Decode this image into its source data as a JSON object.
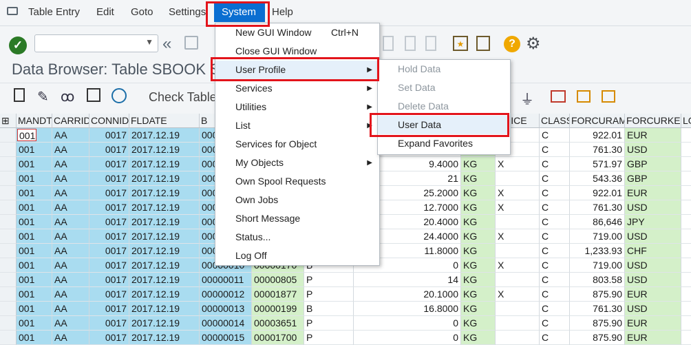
{
  "menubar": {
    "items": [
      {
        "label": "Table Entry"
      },
      {
        "label": "Edit"
      },
      {
        "label": "Goto"
      },
      {
        "label": "Settings"
      },
      {
        "label": "System"
      },
      {
        "label": "Help"
      }
    ]
  },
  "title": "Data Browser: Table SBOOK S",
  "app_toolbar": {
    "check_table": "Check Table"
  },
  "columns": [
    "MANDT",
    "CARRID",
    "CONNID",
    "FLDATE",
    "B",
    "",
    "",
    "",
    "",
    "",
    "VOICE",
    "CLASS",
    "FORCURAM",
    "FORCURKEY",
    "LO"
  ],
  "rows": [
    {
      "mandt": "001",
      "carrid": "AA",
      "connid": "0017",
      "fldate": "2017.12.19",
      "bookid": "000",
      "customid": "",
      "custtype": "",
      "luggweight": "",
      "wunit": "",
      "invoice": "",
      "class": "C",
      "forcuram": "922.01",
      "forcurkey": "EUR"
    },
    {
      "mandt": "001",
      "carrid": "AA",
      "connid": "0017",
      "fldate": "2017.12.19",
      "bookid": "000",
      "customid": "",
      "custtype": "",
      "luggweight": "",
      "wunit": "",
      "invoice": "",
      "class": "C",
      "forcuram": "761.30",
      "forcurkey": "USD"
    },
    {
      "mandt": "001",
      "carrid": "AA",
      "connid": "0017",
      "fldate": "2017.12.19",
      "bookid": "000",
      "customid": "",
      "custtype": "",
      "luggweight": "9.4000",
      "wunit": "KG",
      "invoice": "X",
      "class": "C",
      "forcuram": "571.97",
      "forcurkey": "GBP"
    },
    {
      "mandt": "001",
      "carrid": "AA",
      "connid": "0017",
      "fldate": "2017.12.19",
      "bookid": "000",
      "customid": "",
      "custtype": "",
      "luggweight": "21",
      "wunit": "KG",
      "invoice": "",
      "class": "C",
      "forcuram": "543.36",
      "forcurkey": "GBP"
    },
    {
      "mandt": "001",
      "carrid": "AA",
      "connid": "0017",
      "fldate": "2017.12.19",
      "bookid": "000",
      "customid": "",
      "custtype": "",
      "luggweight": "25.2000",
      "wunit": "KG",
      "invoice": "X",
      "class": "C",
      "forcuram": "922.01",
      "forcurkey": "EUR"
    },
    {
      "mandt": "001",
      "carrid": "AA",
      "connid": "0017",
      "fldate": "2017.12.19",
      "bookid": "000",
      "customid": "",
      "custtype": "",
      "luggweight": "12.7000",
      "wunit": "KG",
      "invoice": "X",
      "class": "C",
      "forcuram": "761.30",
      "forcurkey": "USD"
    },
    {
      "mandt": "001",
      "carrid": "AA",
      "connid": "0017",
      "fldate": "2017.12.19",
      "bookid": "000",
      "customid": "",
      "custtype": "",
      "luggweight": "20.4000",
      "wunit": "KG",
      "invoice": "",
      "class": "C",
      "forcuram": "86,646",
      "forcurkey": "JPY"
    },
    {
      "mandt": "001",
      "carrid": "AA",
      "connid": "0017",
      "fldate": "2017.12.19",
      "bookid": "000",
      "customid": "",
      "custtype": "",
      "luggweight": "24.4000",
      "wunit": "KG",
      "invoice": "X",
      "class": "C",
      "forcuram": "719.00",
      "forcurkey": "USD"
    },
    {
      "mandt": "001",
      "carrid": "AA",
      "connid": "0017",
      "fldate": "2017.12.19",
      "bookid": "000",
      "customid": "",
      "custtype": "",
      "luggweight": "11.8000",
      "wunit": "KG",
      "invoice": "",
      "class": "C",
      "forcuram": "1,233.93",
      "forcurkey": "CHF"
    },
    {
      "mandt": "001",
      "carrid": "AA",
      "connid": "0017",
      "fldate": "2017.12.19",
      "bookid": "00000010",
      "customid": "00000170",
      "custtype": "B",
      "luggweight": "0",
      "wunit": "KG",
      "invoice": "X",
      "class": "C",
      "forcuram": "719.00",
      "forcurkey": "USD"
    },
    {
      "mandt": "001",
      "carrid": "AA",
      "connid": "0017",
      "fldate": "2017.12.19",
      "bookid": "00000011",
      "customid": "00000805",
      "custtype": "P",
      "luggweight": "14",
      "wunit": "KG",
      "invoice": "",
      "class": "C",
      "forcuram": "803.58",
      "forcurkey": "USD"
    },
    {
      "mandt": "001",
      "carrid": "AA",
      "connid": "0017",
      "fldate": "2017.12.19",
      "bookid": "00000012",
      "customid": "00001877",
      "custtype": "P",
      "luggweight": "20.1000",
      "wunit": "KG",
      "invoice": "X",
      "class": "C",
      "forcuram": "875.90",
      "forcurkey": "EUR"
    },
    {
      "mandt": "001",
      "carrid": "AA",
      "connid": "0017",
      "fldate": "2017.12.19",
      "bookid": "00000013",
      "customid": "00000199",
      "custtype": "B",
      "luggweight": "16.8000",
      "wunit": "KG",
      "invoice": "",
      "class": "C",
      "forcuram": "761.30",
      "forcurkey": "USD"
    },
    {
      "mandt": "001",
      "carrid": "AA",
      "connid": "0017",
      "fldate": "2017.12.19",
      "bookid": "00000014",
      "customid": "00003651",
      "custtype": "P",
      "luggweight": "0",
      "wunit": "KG",
      "invoice": "",
      "class": "C",
      "forcuram": "875.90",
      "forcurkey": "EUR"
    },
    {
      "mandt": "001",
      "carrid": "AA",
      "connid": "0017",
      "fldate": "2017.12.19",
      "bookid": "00000015",
      "customid": "00001700",
      "custtype": "P",
      "luggweight": "0",
      "wunit": "KG",
      "invoice": "",
      "class": "C",
      "forcuram": "875.90",
      "forcurkey": "EUR"
    }
  ],
  "system_menu": {
    "items": [
      {
        "label": "New GUI Window",
        "shortcut": "Ctrl+N",
        "arrow": ""
      },
      {
        "label": "Close GUI Window",
        "shortcut": "",
        "arrow": ""
      },
      {
        "label": "User Profile",
        "shortcut": "",
        "arrow": "▶"
      },
      {
        "label": "Services",
        "shortcut": "",
        "arrow": "▶"
      },
      {
        "label": "Utilities",
        "shortcut": "",
        "arrow": "▶"
      },
      {
        "label": "List",
        "shortcut": "",
        "arrow": "▶"
      },
      {
        "label": "Services for Object",
        "shortcut": "",
        "arrow": ""
      },
      {
        "label": "My Objects",
        "shortcut": "",
        "arrow": "▶"
      },
      {
        "label": "Own Spool Requests",
        "shortcut": "",
        "arrow": ""
      },
      {
        "label": "Own Jobs",
        "shortcut": "",
        "arrow": ""
      },
      {
        "label": "Short Message",
        "shortcut": "",
        "arrow": ""
      },
      {
        "label": "Status...",
        "shortcut": "",
        "arrow": ""
      },
      {
        "label": "Log Off",
        "shortcut": "",
        "arrow": ""
      }
    ]
  },
  "user_profile_menu": {
    "items": [
      {
        "label": "Hold Data"
      },
      {
        "label": "Set Data"
      },
      {
        "label": "Delete Data"
      },
      {
        "label": "User Data"
      },
      {
        "label": "Expand Favorites"
      }
    ]
  },
  "colors": {
    "highlight_red": "#e3141b",
    "system_menu_active": "#0a6ed1",
    "key_column_blue": "#a9dcf0",
    "value_column_green": "#d4f0c9"
  }
}
